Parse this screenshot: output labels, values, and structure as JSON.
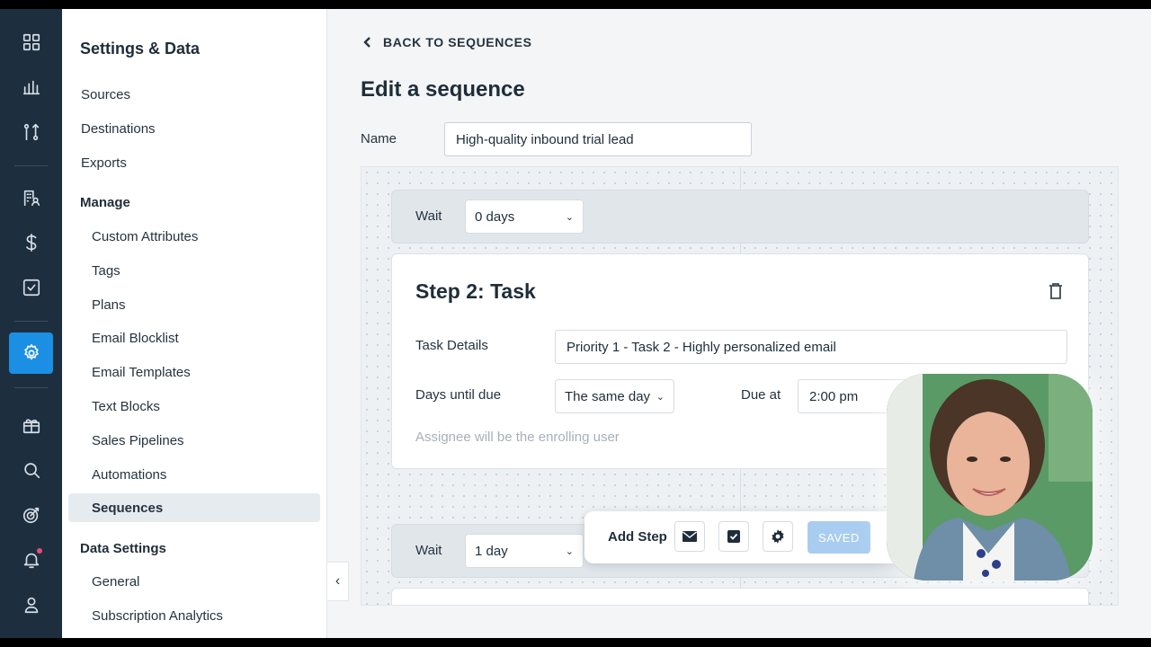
{
  "sidebar": {
    "title": "Settings & Data",
    "items_top": [
      "Sources",
      "Destinations",
      "Exports"
    ],
    "manage": {
      "label": "Manage",
      "items": [
        "Custom Attributes",
        "Tags",
        "Plans",
        "Email Blocklist",
        "Email Templates",
        "Text Blocks",
        "Sales Pipelines",
        "Automations",
        "Sequences"
      ]
    },
    "data_settings": {
      "label": "Data Settings",
      "items": [
        "General",
        "Subscription Analytics"
      ]
    },
    "collapse_glyph": "‹"
  },
  "main": {
    "back_label": "BACK TO SEQUENCES",
    "title": "Edit a sequence",
    "name_label": "Name",
    "name_value": "High-quality inbound trial lead",
    "wait1": {
      "label": "Wait",
      "value": "0 days"
    },
    "step": {
      "title": "Step 2: Task",
      "task_details_label": "Task Details",
      "task_details_value": "Priority 1 - Task 2 - Highly personalized email",
      "days_label": "Days until due",
      "days_value": "The same day",
      "due_label": "Due at",
      "due_value": "2:00 pm",
      "assignee_note": "Assignee will be the enrolling user"
    },
    "wait2": {
      "label": "Wait",
      "value": "1 day"
    },
    "toolbar": {
      "add_step_label": "Add Step",
      "saved_label": "SAVED"
    }
  },
  "chevron_glyph": "⌄",
  "colors": {
    "rail": "#1d2f3f",
    "accent": "#1a8fe3",
    "saved": "#a9cdf0"
  }
}
